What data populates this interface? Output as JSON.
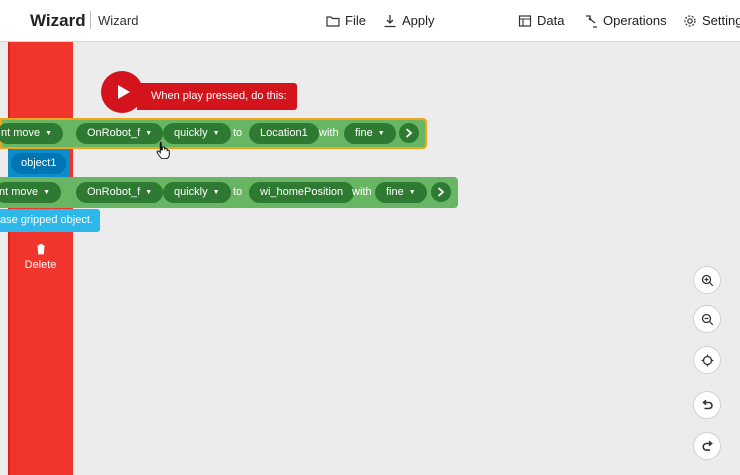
{
  "header": {
    "brand": "Wizard",
    "breadcrumb": "Wizard",
    "menu": {
      "file": "File",
      "apply": "Apply",
      "data": "Data",
      "operations": "Operations",
      "settings": "Settings"
    }
  },
  "sidebar": {
    "delete_label": "Delete"
  },
  "program": {
    "trigger": "When play pressed, do this:",
    "steps": [
      {
        "action": "nt move",
        "device": "OnRobot_f",
        "speed": "quickly",
        "to_word": "to",
        "target": "Location1",
        "with_word": "with",
        "precision": "fine"
      },
      {
        "action": "nt move",
        "device": "OnRobot_f",
        "speed": "quickly",
        "to_word": "to",
        "target": "wi_homePosition",
        "with_word": "with",
        "precision": "fine"
      }
    ],
    "object_chip": "object1",
    "release_chip": "ase gripped object."
  },
  "colors": {
    "accent_red": "#d4141c",
    "trash_zone": "#f0352d",
    "block_green": "#68b563",
    "pill_green": "#2e7a32",
    "selection": "#f2a51a"
  }
}
